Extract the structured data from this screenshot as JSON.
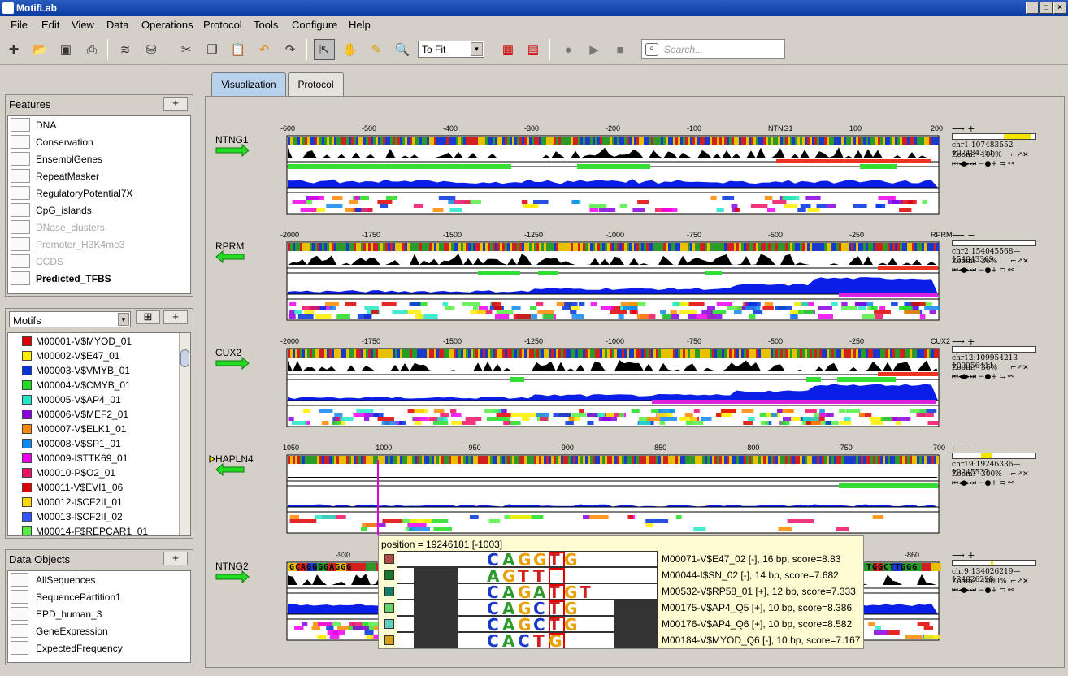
{
  "app": {
    "title": "MotifLab"
  },
  "menu": [
    "File",
    "Edit",
    "View",
    "Data",
    "Operations",
    "Protocol",
    "Tools",
    "Configure",
    "Help"
  ],
  "toolbar": {
    "zoom_value": "To Fit",
    "search_placeholder": "Search..."
  },
  "features": {
    "header": "Features",
    "add": "+",
    "items": [
      {
        "label": "DNA",
        "icon": "dna-track-icon",
        "enabled": true
      },
      {
        "label": "Conservation",
        "icon": "numeric-track-icon",
        "enabled": true
      },
      {
        "label": "EnsemblGenes",
        "icon": "region-track-icon",
        "enabled": true
      },
      {
        "label": "RepeatMasker",
        "icon": "region-track-icon",
        "enabled": true
      },
      {
        "label": "RegulatoryPotential7X",
        "icon": "numeric-track-icon",
        "enabled": true
      },
      {
        "label": "CpG_islands",
        "icon": "region-track-icon",
        "enabled": true
      },
      {
        "label": "DNase_clusters",
        "icon": "hidden-track-icon",
        "enabled": false
      },
      {
        "label": "Promoter_H3K4me3",
        "icon": "hidden-track-icon",
        "enabled": false
      },
      {
        "label": "CCDS",
        "icon": "hidden-track-icon",
        "enabled": false
      },
      {
        "label": "Predicted_TFBS",
        "icon": "motif-track-icon",
        "enabled": true,
        "bold": true
      }
    ]
  },
  "motifs": {
    "selector": "Motifs",
    "add": "+",
    "items": [
      {
        "label": "M00001-V$MYOD_01",
        "color": "#e00000"
      },
      {
        "label": "M00002-V$E47_01",
        "color": "#ffee00"
      },
      {
        "label": "M00003-V$VMYB_01",
        "color": "#0033dd"
      },
      {
        "label": "M00004-V$CMYB_01",
        "color": "#22dd22"
      },
      {
        "label": "M00005-V$AP4_01",
        "color": "#22e8c8"
      },
      {
        "label": "M00006-V$MEF2_01",
        "color": "#8a00e0"
      },
      {
        "label": "M00007-V$ELK1_01",
        "color": "#ff8800"
      },
      {
        "label": "M00008-V$SP1_01",
        "color": "#1188ee"
      },
      {
        "label": "M00009-I$TTK69_01",
        "color": "#ee00ee"
      },
      {
        "label": "M00010-P$O2_01",
        "color": "#ee1166"
      },
      {
        "label": "M00011-V$EVI1_06",
        "color": "#dd0000"
      },
      {
        "label": "M00012-I$CF2II_01",
        "color": "#ffd800"
      },
      {
        "label": "M00013-I$CF2II_02",
        "color": "#3355ff"
      },
      {
        "label": "M00014-F$REPCAR1_01",
        "color": "#55ee44"
      }
    ]
  },
  "data_objects": {
    "header": "Data Objects",
    "add": "+",
    "items": [
      {
        "label": "AllSequences",
        "icon": "collection-icon"
      },
      {
        "label": "SequencePartition1",
        "icon": "partition-icon"
      },
      {
        "label": "EPD_human_3",
        "icon": "koala-icon"
      },
      {
        "label": "GeneExpression",
        "icon": "heatmap-icon"
      },
      {
        "label": "ExpectedFrequency",
        "icon": "xm-icon"
      }
    ]
  },
  "tabs": [
    "Visualization",
    "Protocol"
  ],
  "sequences": [
    {
      "name": "NTNG1",
      "strand": "+",
      "ticks": [
        "-600",
        "-500",
        "-400",
        "-300",
        "-200",
        "-100",
        "NTNG1",
        "100",
        "200"
      ],
      "coords": "chr1:107483552—107484351",
      "zoom": "100%",
      "bar": [
        0.62,
        0.94
      ]
    },
    {
      "name": "RPRM",
      "strand": "-",
      "ticks": [
        "-2000",
        "-1750",
        "-1500",
        "-1250",
        "-1000",
        "-750",
        "-500",
        "-250",
        "RPRM"
      ],
      "coords": "chr2:154045568—154043369",
      "zoom": "36%",
      "bar": [
        0,
        0
      ]
    },
    {
      "name": "CUX2",
      "strand": "+",
      "ticks": [
        "-2000",
        "-1750",
        "-1500",
        "-1250",
        "-1000",
        "-750",
        "-500",
        "-250",
        "CUX2"
      ],
      "coords": "chr12:109954213—109956411",
      "zoom": "36%",
      "bar": [
        0,
        0
      ]
    },
    {
      "name": "HAPLN4",
      "strand": "-",
      "ticks": [
        "-1050",
        "-1000",
        "-950",
        "-900",
        "-850",
        "-800",
        "-750",
        "-700"
      ],
      "coords": "chr19:19246336—19245537",
      "zoom": "300%",
      "bar": [
        0.34,
        0.48
      ]
    },
    {
      "name": "NTNG2",
      "strand": "+",
      "ticks": [
        "-930",
        "-860"
      ],
      "coords": "chr9:134026219—134026298",
      "zoom": "1000%",
      "bar": [
        0.46,
        0.49
      ],
      "dna": "GCAGGGGAGGG",
      "dna2": "TGGCTTGGG"
    }
  ],
  "info_labels": {
    "zoom": "Zoom:"
  },
  "tooltip": {
    "position": "position = 19246181 [-1003]",
    "rows": [
      {
        "color": "#b04a4a",
        "desc": "M00071-V$E47_02 [-], 16 bp, score=8.83",
        "logo": "CAGGTG"
      },
      {
        "color": "#1a7a2a",
        "desc": "M00044-I$SN_02 [-], 14 bp, score=7.682",
        "logo": "AGTT"
      },
      {
        "color": "#1a7a6a",
        "desc": "M00532-V$RP58_01 [+], 12 bp, score=7.333",
        "logo": "CAGATGT"
      },
      {
        "color": "#6ad06a",
        "desc": "M00175-V$AP4_Q5 [+], 10 bp, score=8.386",
        "logo": "CAGCTG"
      },
      {
        "color": "#66d0c0",
        "desc": "M00176-V$AP4_Q6 [+], 10 bp, score=8.582",
        "logo": "CAGCTG"
      },
      {
        "color": "#d8a020",
        "desc": "M00184-V$MYOD_Q6 [-], 10 bp, score=7.167",
        "logo": "CACTG"
      }
    ]
  }
}
